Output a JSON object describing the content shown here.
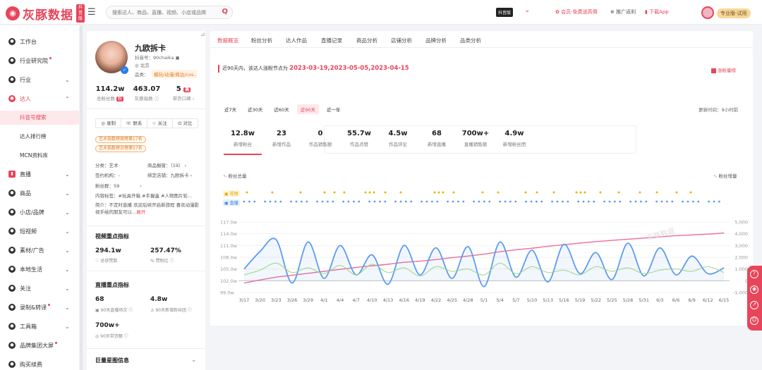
{
  "topbar": {
    "logo_text": "灰豚数据",
    "logo_tag": "抖音版",
    "search_placeholder": "搜索达人、商品、直播、视频、小店或品牌",
    "env_badge": "抖音版",
    "member_link": "会员-免费送高佣",
    "promo_link": "推广返利",
    "app_link": "下载App",
    "plan_badge": "专业版-试用"
  },
  "sidebar": {
    "items": [
      {
        "label": "工作台",
        "icon": "workbench-icon"
      },
      {
        "label": "行业研究院",
        "icon": "research-icon",
        "dot": true
      },
      {
        "label": "行业",
        "icon": "industry-icon",
        "chevron": "expand"
      },
      {
        "label": "达人",
        "icon": "influencer-icon",
        "chevron": "collapse",
        "active": true
      },
      {
        "label": "直播",
        "icon": "live-icon",
        "chevron": "expand"
      },
      {
        "label": "商品",
        "icon": "goods-icon",
        "chevron": "expand"
      },
      {
        "label": "小店/品牌",
        "icon": "shop-icon",
        "chevron": "expand"
      },
      {
        "label": "短视频",
        "icon": "video-icon",
        "chevron": "expand"
      },
      {
        "label": "素材/广告",
        "icon": "ad-icon",
        "chevron": "expand"
      },
      {
        "label": "本地生活",
        "icon": "local-icon",
        "chevron": "expand"
      },
      {
        "label": "关注",
        "icon": "follow-icon",
        "chevron": "expand"
      },
      {
        "label": "录制&转译",
        "icon": "record-icon",
        "chevron": "expand",
        "dot": true
      },
      {
        "label": "工具箱",
        "icon": "toolbox-icon",
        "chevron": "expand"
      },
      {
        "label": "品牌集团大屏",
        "icon": "screen-icon",
        "dot": true
      },
      {
        "label": "购买续费",
        "icon": "purchase-icon"
      }
    ],
    "subitems": [
      {
        "label": "抖音号搜索",
        "active": true
      },
      {
        "label": "达人排行榜"
      },
      {
        "label": "MCN资料库"
      }
    ]
  },
  "profile": {
    "name": "九欧拆卡",
    "douyin_id": "抖音号：90chaika",
    "location": "北京",
    "category_label": "品类：",
    "category": "模玩/动漫/周边/cos...",
    "stats": [
      {
        "value": "114.2w",
        "label": "总粉丝数",
        "badge": "粉"
      },
      {
        "value": "463.07",
        "label": "灰豚指数"
      },
      {
        "value": "5",
        "badge": "高",
        "label": "带货口碑"
      }
    ],
    "actions": [
      "录制",
      "联系",
      "关注",
      "对比"
    ],
    "tags": [
      "艺术指数榜周榜第17名",
      "艺术指数榜日榜第57名"
    ],
    "info": {
      "category": "分类：艺术",
      "goods_window": "商品橱窗：（19）",
      "agency": "签约机构：-",
      "bound_shop": "绑定店铺：九欧拆卡",
      "fan_group": "粉丝群：59",
      "content_tags": "内容标签：#玩具开箱 #手握盒 #人物图片轮...",
      "bio": "简介：不定时直播 欢迎后续开启新旅程 喜欢动漫影视手绘的朋友可以...",
      "bio_more": "展开"
    },
    "video_section": {
      "title": "视频重点指标",
      "likes_value": "294.1w",
      "likes_label": "总获赞数",
      "ratio_value": "257.47%",
      "ratio_label": "赞粉比"
    },
    "live_section": {
      "title": "直播重点指标",
      "count_value": "68",
      "count_label": "90天直播场次",
      "fans_value": "4.8w",
      "fans_label": "90天新增粉丝团",
      "sales_value": "700w+",
      "sales_label": "90天带货额"
    },
    "next_section": "巨量星图信息"
  },
  "main": {
    "tabs": [
      "数据概览",
      "粉丝分析",
      "达人作品",
      "直播记录",
      "商品分析",
      "店铺分析",
      "品牌分析",
      "品类分析"
    ],
    "notice_prefix": "近90天内，该达人涨粉节点为",
    "notice_dates": "2023-03-19,2023-05-05,2023-04-15",
    "notice_btn": "涨粉量榜",
    "periods": [
      "近7天",
      "近30天",
      "近60天",
      "近90天",
      "近一年"
    ],
    "active_period": 3,
    "update_time": "更新时间：9小时前",
    "metrics": [
      {
        "value": "12.8w",
        "label": "新增粉丝",
        "active": true
      },
      {
        "value": "23",
        "label": "新增作品"
      },
      {
        "value": "0",
        "label": "作品销售额"
      },
      {
        "value": "55.7w",
        "label": "作品点赞"
      },
      {
        "value": "4.5w",
        "label": "作品评论"
      },
      {
        "value": "68",
        "label": "新增直播"
      },
      {
        "value": "700w+",
        "label": "直播销售额"
      },
      {
        "value": "4.9w",
        "label": "新增粉丝团"
      }
    ],
    "legend_left": "粉丝总量",
    "legend_right": "粉丝增量",
    "event_video": "视频",
    "event_live": "直播"
  },
  "chart_data": {
    "type": "line",
    "x": [
      "3/17",
      "3/20",
      "3/23",
      "3/26",
      "3/29",
      "4/1",
      "4/4",
      "4/7",
      "4/10",
      "4/13",
      "4/16",
      "4/19",
      "4/22",
      "4/25",
      "4/28",
      "5/1",
      "5/4",
      "5/7",
      "5/10",
      "5/13",
      "5/16",
      "5/19",
      "5/22",
      "5/25",
      "5/28",
      "5/31",
      "6/3",
      "6/6",
      "6/9",
      "6/12",
      "6/15"
    ],
    "y_left_ticks": [
      "99.0w",
      "102.0w",
      "105.0w",
      "108.0w",
      "111.0w",
      "114.0w",
      "117.0w"
    ],
    "y_left_range": [
      99.0,
      117.0
    ],
    "y_right_ticks": [
      "-1,000",
      "0",
      "1,000",
      "2,000",
      "3,000",
      "4,000",
      "5,000"
    ],
    "y_right_range": [
      -1000,
      5000
    ],
    "series": [
      {
        "name": "粉丝总量",
        "color": "#f06a99",
        "axis": "left",
        "values": [
          101.4,
          102.2,
          102.9,
          103.4,
          103.9,
          104.4,
          104.9,
          105.4,
          105.8,
          106.2,
          106.7,
          107.0,
          107.4,
          107.9,
          108.3,
          108.8,
          109.4,
          109.9,
          110.3,
          110.8,
          111.2,
          111.6,
          112.0,
          112.3,
          112.6,
          112.9,
          113.2,
          113.5,
          113.7,
          113.9,
          114.2
        ]
      },
      {
        "name": "粉丝增量",
        "color": "#5b9cf0",
        "axis": "right",
        "values": [
          1000,
          2500,
          3500,
          -200,
          3300,
          200,
          3000,
          500,
          2200,
          -300,
          3000,
          500,
          2800,
          200,
          2900,
          -500,
          3300,
          300,
          2600,
          -100,
          3100,
          600,
          2400,
          100,
          3200,
          400,
          2800,
          500,
          2100,
          600,
          1100
        ]
      },
      {
        "color": "#9ed37d",
        "axis": "right",
        "values": [
          500,
          900,
          1500,
          700,
          1100,
          600,
          1300,
          500,
          1400,
          700,
          1100,
          400,
          1200,
          800,
          1000,
          500,
          1500,
          600,
          1200,
          700,
          900,
          500,
          1200,
          800,
          1100,
          600,
          900,
          1000,
          800,
          1200,
          700
        ]
      }
    ],
    "grid": true
  },
  "floating": [
    "help-icon",
    "service-icon",
    "share-icon",
    "feedback-icon"
  ]
}
